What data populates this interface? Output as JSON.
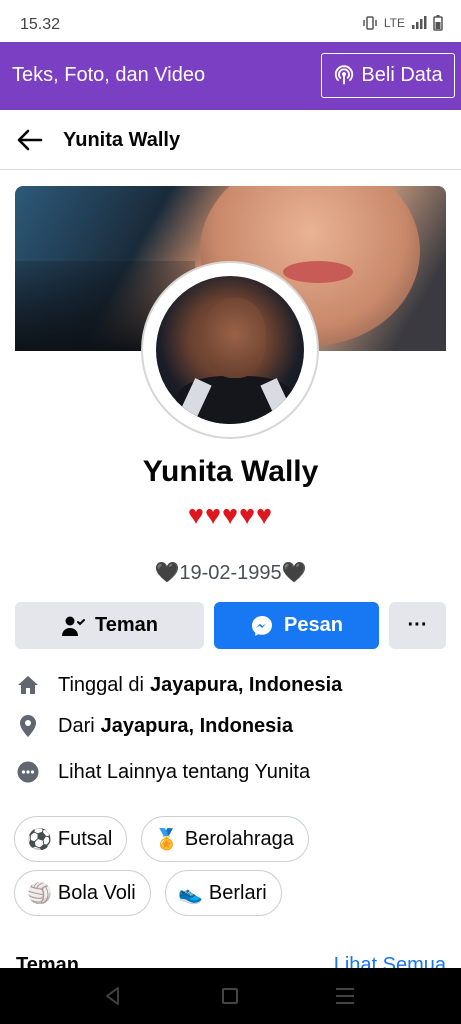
{
  "status_bar": {
    "time": "15.32",
    "network": "LTE"
  },
  "promo": {
    "text": "Teks, Foto, dan Video",
    "button_label": "Beli Data"
  },
  "header": {
    "title": "Yunita Wally"
  },
  "profile": {
    "name": "Yunita Wally",
    "hearts": "♥♥♥♥♥",
    "birth_heart": "🖤",
    "birth_date": "19-02-1995"
  },
  "actions": {
    "friend_label": "Teman",
    "message_label": "Pesan",
    "more_label": "···"
  },
  "info": {
    "lives_prefix": "Tinggal di",
    "lives_place": "Jayapura, Indonesia",
    "from_prefix": "Dari",
    "from_place": "Jayapura, Indonesia",
    "see_more": "Lihat Lainnya tentang Yunita"
  },
  "hobbies": [
    {
      "emoji": "⚽",
      "label": "Futsal"
    },
    {
      "emoji": "🏅",
      "label": "Berolahraga"
    },
    {
      "emoji": "🏐",
      "label": "Bola Voli"
    },
    {
      "emoji": "👟",
      "label": "Berlari"
    }
  ],
  "friends": {
    "title": "Teman",
    "see_all": "Lihat Semua"
  },
  "colors": {
    "promo_bg": "#7b3fc4",
    "primary": "#1877f2",
    "button_gray": "#e4e6eb",
    "heart_red": "#e0161e"
  }
}
